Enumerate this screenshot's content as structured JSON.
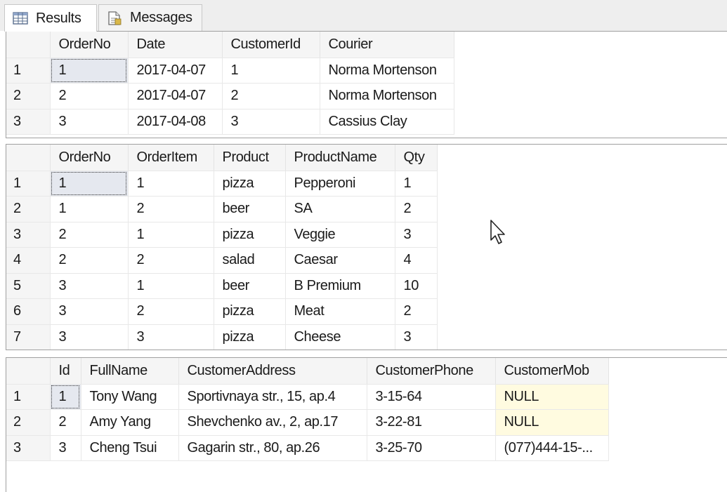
{
  "tabs": [
    {
      "label": "Results",
      "icon": "grid-icon"
    },
    {
      "label": "Messages",
      "icon": "document-icon"
    }
  ],
  "result_sets": [
    {
      "columns": [
        "OrderNo",
        "Date",
        "CustomerId",
        "Courier"
      ],
      "rows": [
        {
          "n": "1",
          "cells": [
            "1",
            "2017-04-07",
            "1",
            "Norma Mortenson"
          ]
        },
        {
          "n": "2",
          "cells": [
            "2",
            "2017-04-07",
            "2",
            "Norma Mortenson"
          ]
        },
        {
          "n": "3",
          "cells": [
            "3",
            "2017-04-08",
            "3",
            "Cassius Clay"
          ]
        }
      ]
    },
    {
      "columns": [
        "OrderNo",
        "OrderItem",
        "Product",
        "ProductName",
        "Qty"
      ],
      "rows": [
        {
          "n": "1",
          "cells": [
            "1",
            "1",
            "pizza",
            "Pepperoni",
            "1"
          ]
        },
        {
          "n": "2",
          "cells": [
            "1",
            "2",
            "beer",
            "SA",
            "2"
          ]
        },
        {
          "n": "3",
          "cells": [
            "2",
            "1",
            "pizza",
            "Veggie",
            "3"
          ]
        },
        {
          "n": "4",
          "cells": [
            "2",
            "2",
            "salad",
            "Caesar",
            "4"
          ]
        },
        {
          "n": "5",
          "cells": [
            "3",
            "1",
            "beer",
            "B Premium",
            "10"
          ]
        },
        {
          "n": "6",
          "cells": [
            "3",
            "2",
            "pizza",
            "Meat",
            "2"
          ]
        },
        {
          "n": "7",
          "cells": [
            "3",
            "3",
            "pizza",
            "Cheese",
            "3"
          ]
        }
      ]
    },
    {
      "columns": [
        "Id",
        "FullName",
        "CustomerAddress",
        "CustomerPhone",
        "CustomerMob"
      ],
      "rows": [
        {
          "n": "1",
          "cells": [
            "1",
            "Tony Wang",
            "Sportivnaya str., 15, ap.4",
            "3-15-64",
            "NULL"
          ]
        },
        {
          "n": "2",
          "cells": [
            "2",
            "Amy Yang",
            "Shevchenko av., 2, ap.17",
            "3-22-81",
            "NULL"
          ]
        },
        {
          "n": "3",
          "cells": [
            "3",
            "Cheng Tsui",
            "Gagarin str., 80, ap.26",
            "3-25-70",
            "(077)444-15-..."
          ]
        }
      ]
    }
  ],
  "selected_cell": {
    "row": 0,
    "col": 0
  },
  "colors": {
    "null_highlight": "#fffbe0",
    "selected_cell": "#e5e8ef",
    "header_bg": "#f5f5f5"
  },
  "cursor_icon": "mouse-pointer-icon"
}
